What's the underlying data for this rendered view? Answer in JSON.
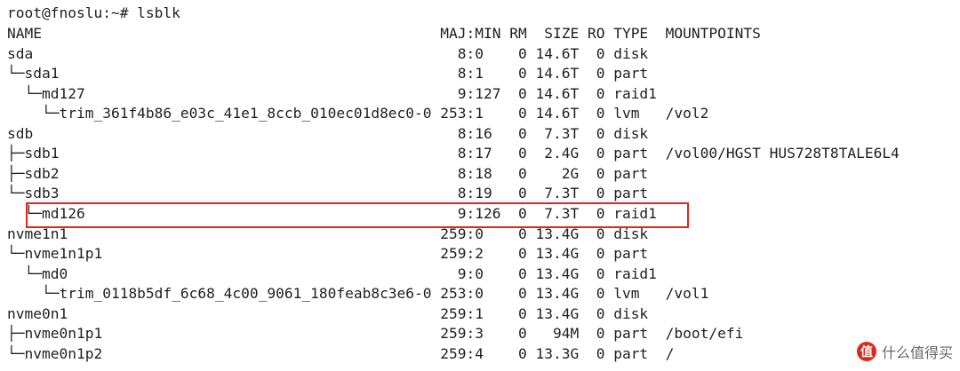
{
  "terminal": {
    "prompt_line": "root@fnoslu:~# lsblk",
    "header_line": "NAME                                              MAJ:MIN RM  SIZE RO TYPE  MOUNTPOINTS",
    "rows": [
      "sda                                                 8:0    0 14.6T  0 disk",
      "└─sda1                                              8:1    0 14.6T  0 part",
      "  └─md127                                           9:127  0 14.6T  0 raid1",
      "    └─trim_361f4b86_e03c_41e1_8ccb_010ec01d8ec0-0 253:1    0 14.6T  0 lvm   /vol2",
      "sdb                                                 8:16   0  7.3T  0 disk",
      "├─sdb1                                              8:17   0  2.4G  0 part  /vol00/HGST HUS728T8TALE6L4",
      "├─sdb2                                              8:18   0    2G  0 part",
      "└─sdb3                                              8:19   0  7.3T  0 part",
      "  └─md126                                           9:126  0  7.3T  0 raid1",
      "nvme1n1                                           259:0    0 13.4G  0 disk",
      "└─nvme1n1p1                                       259:2    0 13.4G  0 part",
      "  └─md0                                             9:0    0 13.4G  0 raid1",
      "    └─trim_0118b5df_6c68_4c00_9061_180feab8c3e6-0 253:0    0 13.4G  0 lvm   /vol1",
      "nvme0n1                                           259:1    0 13.4G  0 disk",
      "├─nvme0n1p1                                       259:3    0   94M  0 part  /boot/efi",
      "└─nvme0n1p2                                       259:4    0 13.3G  0 part  /"
    ]
  },
  "watermark": {
    "badge": "值",
    "text": "什么值得买"
  },
  "colors": {
    "highlight_box": "#e1251b",
    "text": "#1f1f1f",
    "background": "#ffffff"
  }
}
